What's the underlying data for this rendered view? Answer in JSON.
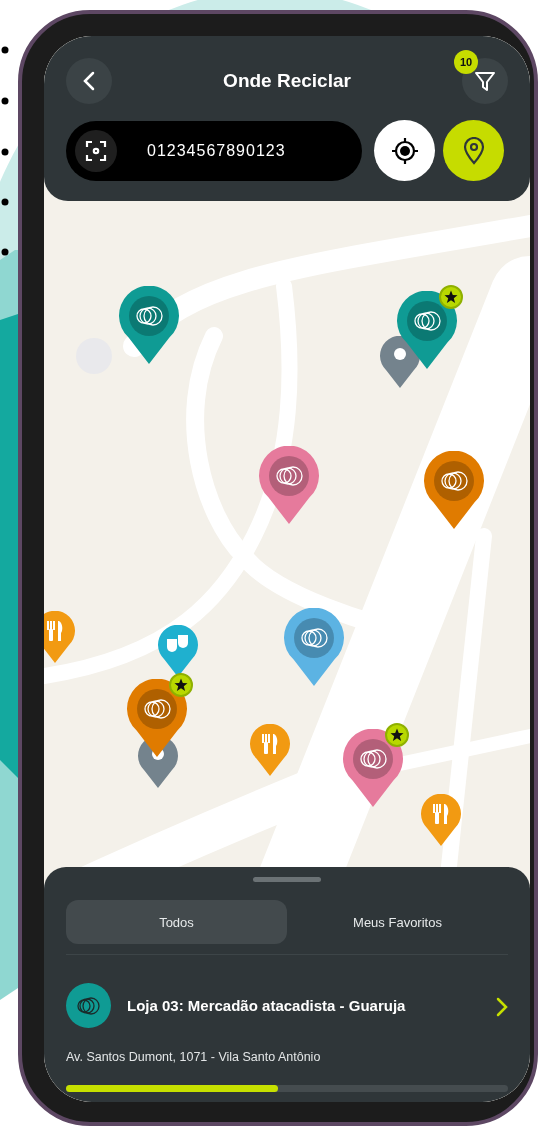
{
  "header": {
    "title": "Onde Reciclar",
    "filter_badge": "10"
  },
  "search": {
    "value": "01234567890123"
  },
  "map": {
    "pins": [
      {
        "kind": "recycle",
        "color": "#0f9b94",
        "favorite": false
      },
      {
        "kind": "recycle",
        "color": "#0f9b94",
        "favorite": true
      },
      {
        "kind": "place",
        "color": "#74838d",
        "favorite": false
      },
      {
        "kind": "recycle",
        "color": "#e67a9c",
        "favorite": false
      },
      {
        "kind": "recycle",
        "color": "#e07b00",
        "favorite": false
      },
      {
        "kind": "restaurant",
        "color": "#f29a12",
        "favorite": false
      },
      {
        "kind": "recycle",
        "color": "#5cb3e3",
        "favorite": false
      },
      {
        "kind": "theater",
        "color": "#1fb0cf",
        "favorite": false
      },
      {
        "kind": "place",
        "color": "#74838d",
        "favorite": false
      },
      {
        "kind": "recycle",
        "color": "#e07b00",
        "favorite": true
      },
      {
        "kind": "restaurant",
        "color": "#f29a12",
        "favorite": false
      },
      {
        "kind": "recycle",
        "color": "#e67a9c",
        "favorite": true
      },
      {
        "kind": "restaurant",
        "color": "#f29a12",
        "favorite": false
      }
    ]
  },
  "sheet": {
    "tabs": [
      {
        "label": "Todos",
        "selected": true
      },
      {
        "label": "Meus Favoritos",
        "selected": false
      }
    ],
    "places": [
      {
        "title": "Loja 03: Mercadão atacadista - Guaruja",
        "address": "Av. Santos Dumont, 1071 - Vila Santo Antônio"
      }
    ],
    "progress": {
      "level": 0.48
    }
  }
}
